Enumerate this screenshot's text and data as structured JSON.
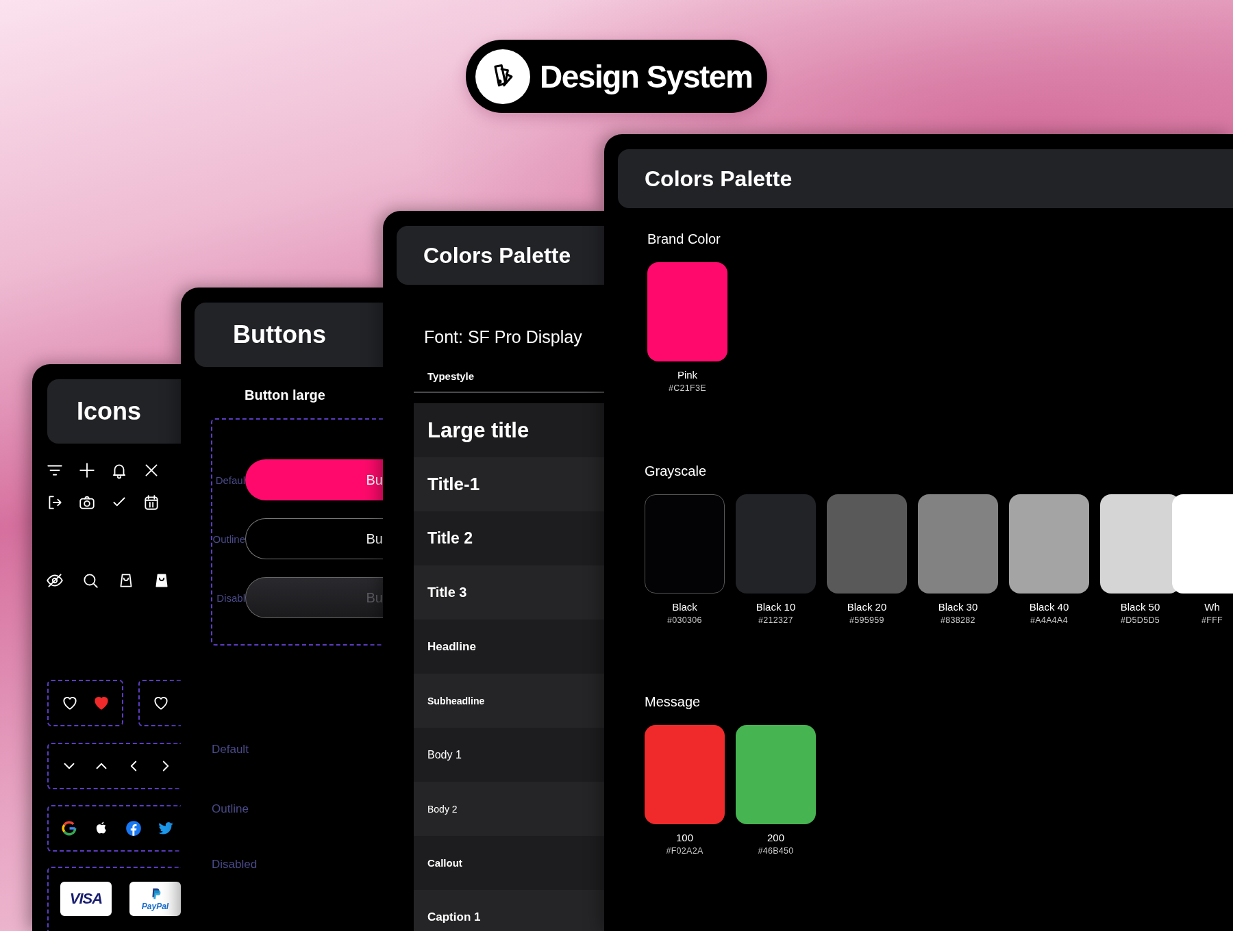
{
  "header": {
    "title": "Design System"
  },
  "icons_panel": {
    "title": "Icons",
    "payment_logos": [
      "VISA",
      "PayPal"
    ]
  },
  "buttons_panel": {
    "title": "Buttons",
    "section_title": "Button large",
    "buttons": [
      {
        "kind": "filled",
        "state_label": "Defaul",
        "label": "Bu"
      },
      {
        "kind": "outline",
        "state_label": "Outline",
        "label": "Bu"
      },
      {
        "kind": "disabled",
        "state_label": "Disabl",
        "label": "Bu"
      }
    ],
    "faint_labels": [
      "Default",
      "Outline",
      "Disabled"
    ]
  },
  "typestyle_panel": {
    "title": "Colors Palette",
    "font_label": "Font: SF Pro Display",
    "column_header": "Typestyle",
    "styles": [
      {
        "kind": "large-title",
        "name": "Large title"
      },
      {
        "kind": "title-1",
        "name": "Title-1"
      },
      {
        "kind": "title-2",
        "name": "Title 2"
      },
      {
        "kind": "title-3",
        "name": "Title 3"
      },
      {
        "kind": "headline",
        "name": "Headline"
      },
      {
        "kind": "subheadline",
        "name": "Subheadline"
      },
      {
        "kind": "body-1",
        "name": "Body 1"
      },
      {
        "kind": "body-2",
        "name": "Body 2"
      },
      {
        "kind": "callout",
        "name": "Callout"
      },
      {
        "kind": "caption-1",
        "name": "Caption 1"
      }
    ]
  },
  "colors_panel": {
    "title": "Colors Palette",
    "sections": [
      {
        "title": "Brand Color",
        "swatches": [
          {
            "name": "Pink",
            "hex": "#C21F3E",
            "color": "#ff0a6c"
          }
        ]
      },
      {
        "title": "Grayscale",
        "swatches": [
          {
            "name": "Black",
            "hex": "#030306",
            "color": "#030306"
          },
          {
            "name": "Black 10",
            "hex": "#212327",
            "color": "#212327"
          },
          {
            "name": "Black 20",
            "hex": "#595959",
            "color": "#595959"
          },
          {
            "name": "Black 30",
            "hex": "#838282",
            "color": "#838282"
          },
          {
            "name": "Black 40",
            "hex": "#A4A4A4",
            "color": "#a4a4a4"
          },
          {
            "name": "Black 50",
            "hex": "#D5D5D5",
            "color": "#d5d5d5"
          },
          {
            "name": "Wh",
            "hex": "#FFF",
            "color": "#ffffff"
          }
        ]
      },
      {
        "title": "Message",
        "swatches": [
          {
            "name": "100",
            "hex": "#F02A2A",
            "color": "#f02a2a"
          },
          {
            "name": "200",
            "hex": "#46B450",
            "color": "#46b450"
          }
        ]
      }
    ]
  }
}
